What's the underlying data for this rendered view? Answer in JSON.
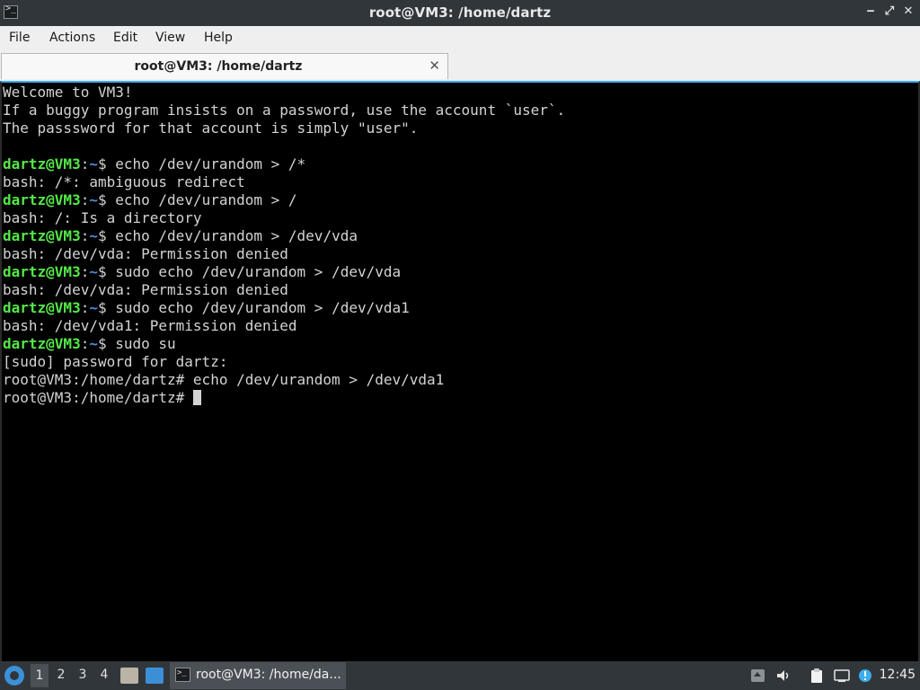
{
  "window": {
    "title": "root@VM3: /home/dartz",
    "app_icon_glyph": ">_",
    "minimize_glyph": "‒",
    "maximize_glyph": "⤢",
    "close_glyph": "✕"
  },
  "menu": [
    "File",
    "Actions",
    "Edit",
    "View",
    "Help"
  ],
  "tab": {
    "label": "root@VM3: /home/dartz",
    "close_glyph": "✕"
  },
  "terminal": {
    "lines": [
      {
        "kind": "text",
        "text": "Welcome to VM3!"
      },
      {
        "kind": "text",
        "text": "If a buggy program insists on a password, use the account `user`."
      },
      {
        "kind": "text",
        "text": "The passsword for that account is simply \"user\"."
      },
      {
        "kind": "text",
        "text": ""
      },
      {
        "kind": "prompt",
        "user": "dartz@VM3",
        "sep": ":",
        "path": "~",
        "sym": "$ ",
        "cmd": "echo /dev/urandom > /*"
      },
      {
        "kind": "text",
        "text": "bash: /*: ambiguous redirect"
      },
      {
        "kind": "prompt",
        "user": "dartz@VM3",
        "sep": ":",
        "path": "~",
        "sym": "$ ",
        "cmd": "echo /dev/urandom > /"
      },
      {
        "kind": "text",
        "text": "bash: /: Is a directory"
      },
      {
        "kind": "prompt",
        "user": "dartz@VM3",
        "sep": ":",
        "path": "~",
        "sym": "$ ",
        "cmd": "echo /dev/urandom > /dev/vda"
      },
      {
        "kind": "text",
        "text": "bash: /dev/vda: Permission denied"
      },
      {
        "kind": "prompt",
        "user": "dartz@VM3",
        "sep": ":",
        "path": "~",
        "sym": "$ ",
        "cmd": "sudo echo /dev/urandom > /dev/vda"
      },
      {
        "kind": "text",
        "text": "bash: /dev/vda: Permission denied"
      },
      {
        "kind": "prompt",
        "user": "dartz@VM3",
        "sep": ":",
        "path": "~",
        "sym": "$ ",
        "cmd": "sudo echo /dev/urandom > /dev/vda1"
      },
      {
        "kind": "text",
        "text": "bash: /dev/vda1: Permission denied"
      },
      {
        "kind": "prompt",
        "user": "dartz@VM3",
        "sep": ":",
        "path": "~",
        "sym": "$ ",
        "cmd": "sudo su"
      },
      {
        "kind": "text",
        "text": "[sudo] password for dartz:"
      },
      {
        "kind": "text",
        "text": "root@VM3:/home/dartz# echo /dev/urandom > /dev/vda1"
      },
      {
        "kind": "cursorline",
        "text": "root@VM3:/home/dartz# "
      }
    ]
  },
  "taskbar": {
    "workspaces": [
      "1",
      "2",
      "3",
      "4"
    ],
    "active_workspace": "1",
    "task_icon_glyph": ">_",
    "task_label": "root@VM3: /home/da...",
    "clock": "12:45",
    "colors": {
      "accent": "#3daee9",
      "prompt_user": "#54e847",
      "prompt_path": "#4f8fd8"
    }
  }
}
